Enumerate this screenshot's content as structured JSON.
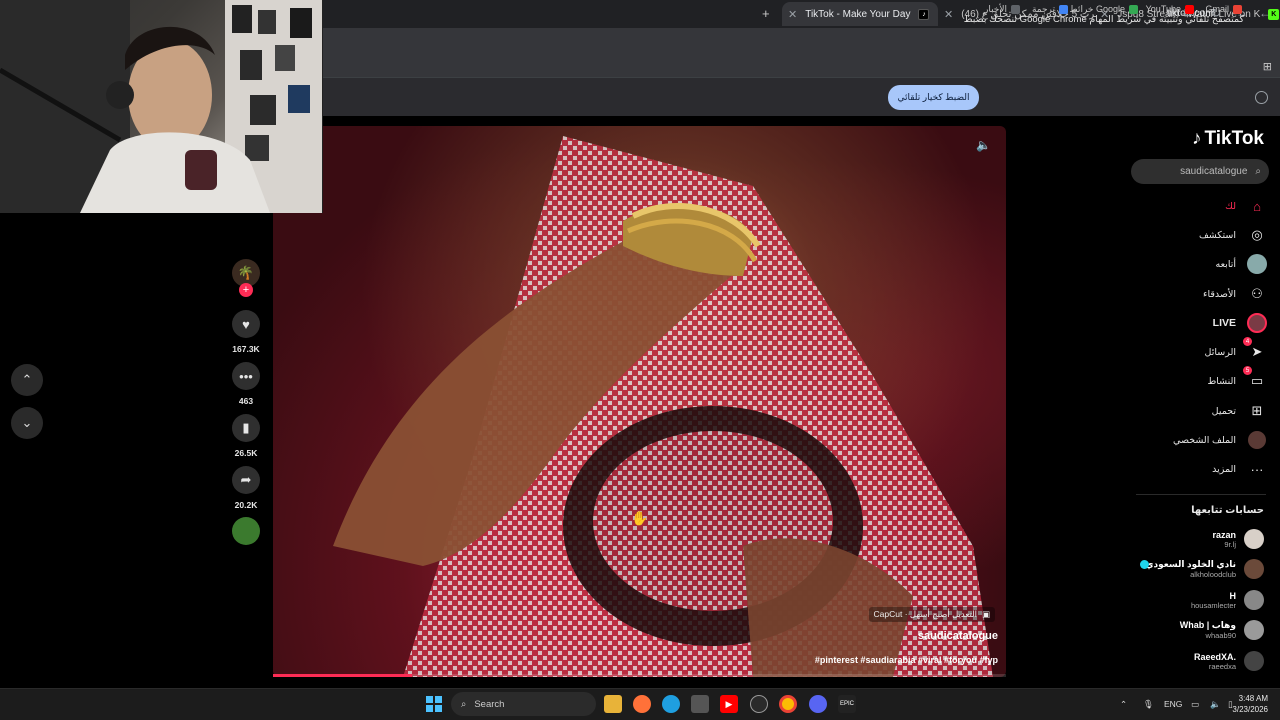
{
  "tabs": [
    {
      "title": "Jspu8 Stream - Watch Live on K",
      "fav_color": "#53fc18",
      "fav_glyph": "K"
    },
    {
      "title": "(46) أغرب 5 حلاقين ممكن تحلق ع",
      "fav_color": "#ff0000",
      "fav_glyph": "▶"
    },
    {
      "title": "TikTok - Make Your Day",
      "fav_color": "#000000",
      "fav_glyph": "♪"
    }
  ],
  "new_tab_label": "+",
  "address": {
    "url": "tiktok.com"
  },
  "bookmarks": [
    {
      "label": "Gmail",
      "color": "#ea4335"
    },
    {
      "label": "YouTube",
      "color": "#ff0000"
    },
    {
      "label": "خرائط Google",
      "color": "#34a853"
    },
    {
      "label": "ترجمة",
      "color": "#4285f4"
    },
    {
      "label": "الأخبار",
      "color": "#5f6368"
    }
  ],
  "infobar": {
    "message": "تنصحك بضبط Google Chrome كمتصفح تلقائي وتثبيته في شريط المهام",
    "button": "الضبط كخيار تلقائي"
  },
  "sidebar": {
    "logo": "TikTok",
    "search_value": "saudicatalogue",
    "items": [
      {
        "label": "لك",
        "icon": "home-icon",
        "glyph": "⌂",
        "accent": true
      },
      {
        "label": "استكشف",
        "icon": "compass-icon",
        "glyph": "◎"
      },
      {
        "label": "أتابعه",
        "icon": "following-avatar-icon",
        "glyph": "●"
      },
      {
        "label": "الأصدقاء",
        "icon": "friends-icon",
        "glyph": "👥"
      },
      {
        "label": "LIVE",
        "icon": "live-icon",
        "glyph": "●"
      },
      {
        "label": "الرسائل",
        "icon": "send-icon",
        "glyph": "➤",
        "badge": "4"
      },
      {
        "label": "النشاط",
        "icon": "activity-icon",
        "glyph": "▭",
        "badge": "5"
      },
      {
        "label": "تحميل",
        "icon": "upload-icon",
        "glyph": "⊞"
      },
      {
        "label": "الملف الشخصي",
        "icon": "profile-avatar-icon",
        "glyph": "●"
      },
      {
        "label": "المزيد",
        "icon": "more-icon",
        "glyph": "···"
      }
    ],
    "following_title": "حسابات تتابعها",
    "accounts": [
      {
        "name": "razan",
        "handle": "9r.lj"
      },
      {
        "name": "نادي الخلود السعودي",
        "handle": "alkholoodclub"
      },
      {
        "name": "H",
        "handle": "housamlecter"
      },
      {
        "name": "Whab | وهاب",
        "handle": "whaab90"
      },
      {
        "name": "RaeedXA.",
        "handle": "raeedxa"
      }
    ]
  },
  "video": {
    "capcut": "CapCut · التعديل أصبح أسهل",
    "author": "saudicatalogue",
    "tags": "#pinterest #saudiarabia #viral #foryou #fyp",
    "progress": 0.19
  },
  "actions": {
    "likes": "167.3K",
    "comments": "463",
    "saves": "26.5K",
    "shares": "20.2K"
  },
  "taskbar": {
    "search_label": "Search",
    "lang": "ENG",
    "time": "3:48 AM",
    "date": "3/23/2026"
  }
}
